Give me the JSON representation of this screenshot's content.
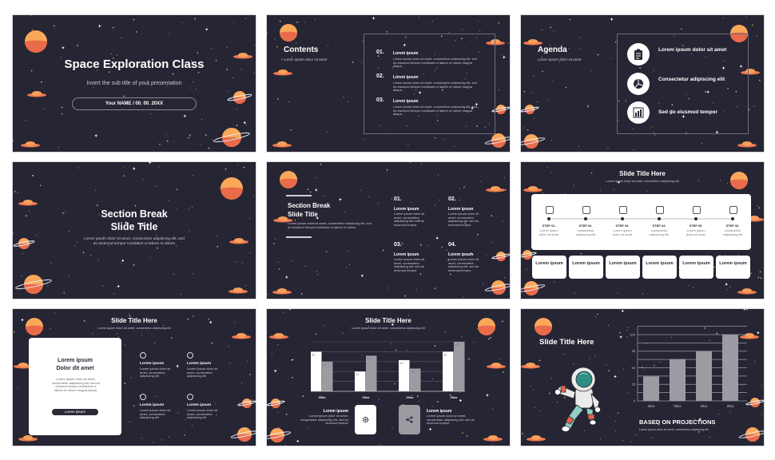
{
  "colors": {
    "background": "#262534",
    "accent_orange": "#f0784f",
    "planet_light": "#f9a85a",
    "bar_gray": "#9b9ba2",
    "white": "#ffffff"
  },
  "slides": [
    {
      "title": "Space Exploration Class",
      "subtitle": "Insert the sub title of your presentation",
      "name_date": "Your NAME  /  00. 00. 20XX"
    },
    {
      "title": "Contents",
      "subtitle": "Lorem ipsum dolor sit amet",
      "items": [
        {
          "num": "01.",
          "title": "Lorem ipsum",
          "desc": "Lorem ipsum dolor sit amet, consectetur adipiscing elit, sed do eiusmod tempor incididunt ut labore et dolore magna aliqua."
        },
        {
          "num": "02.",
          "title": "Lorem ipsum",
          "desc": "Lorem ipsum dolor sit amet, consectetur adipiscing elit, sed do eiusmod tempor incididunt ut labore et dolore magna aliqua."
        },
        {
          "num": "03.",
          "title": "Lorem ipsum",
          "desc": "Lorem ipsum dolor sit amet, consectetur adipiscing elit, sed do eiusmod tempor incididunt ut labore et dolore magna aliqua."
        }
      ]
    },
    {
      "title": "Agenda",
      "subtitle": "Lorem ipsum dolor sit amet",
      "items": [
        {
          "icon": "clipboard-icon",
          "text": "Lorem ipsum dolor sit amet"
        },
        {
          "icon": "pie-chart-icon",
          "text": "Consectetur adipiscing elit"
        },
        {
          "icon": "bar-chart-icon",
          "text": "Sed do eiusmod tempor"
        }
      ]
    },
    {
      "title_line1": "Section Break",
      "title_line2": "Slide Title",
      "desc": "Lorem ipsum dolor sit amet, consectetur adipiscing elit, sed do eiusmod tempor incididunt ut labore et dolore"
    },
    {
      "title_line1": "Section Break",
      "title_line2": "Slide Title",
      "desc": "Lorem ipsum dolor sit amet, consectetur adipiscing elit, sed do eiusmod tempor incididunt ut labore et dolore",
      "items": [
        {
          "num": "01.",
          "title": "Lorem ipsum",
          "desc": "Lorem ipsum dolor sit amet, consectetur adipiscing elit, sed do eiusmod tempor"
        },
        {
          "num": "02.",
          "title": "Lorem ipsum",
          "desc": "Lorem ipsum dolor sit amet, consectetur adipiscing elit, sed do eiusmod tempor"
        },
        {
          "num": "03.",
          "title": "Lorem ipsum",
          "desc": "Lorem ipsum dolor sit amet, consectetur adipiscing elit, sed do eiusmod tempor"
        },
        {
          "num": "04.",
          "title": "Lorem ipsum",
          "desc": "Lorem ipsum dolor sit amet, consectetur adipiscing elit, sed do eiusmod tempor"
        }
      ]
    },
    {
      "title": "Slide Title Here",
      "subtitle": "Lorem ipsum dolor sit amet, consectetur adipiscing elit",
      "steps": [
        {
          "icon": "puzzle-icon",
          "label": "STEP 01.",
          "desc": "Lorem ipsum dolor sit amet"
        },
        {
          "icon": "camera-icon",
          "label": "STEP 02.",
          "desc": "consectetur adipiscing elit"
        },
        {
          "icon": "image-icon",
          "label": "STEP 03.",
          "desc": "Lorem ipsum dolor sit amet"
        },
        {
          "icon": "globe-icon",
          "label": "STEP 04.",
          "desc": "consectetur adipiscing elit"
        },
        {
          "icon": "calendar-icon",
          "label": "STEP 05.",
          "desc": "Lorem ipsum dolor sit amet"
        },
        {
          "icon": "gear-icon",
          "label": "STEP 06.",
          "desc": "consectetur adipiscing elit"
        }
      ],
      "boxes": [
        "Lorem ipsum",
        "Lorem ipsum",
        "Lorem ipsum",
        "Lorem ipsum",
        "Lorem ipsum",
        "Lorem ipsum"
      ]
    },
    {
      "title": "Slide Title Here",
      "subtitle": "Lorem ipsum dolor sit amet, consectetur adipiscing elit",
      "card": {
        "title_line1": "Lorem ipsum",
        "title_line2": "Dolor dit amet",
        "desc": "Lorem ipsum dolor sit amet, consectetur adipiscing elit, sed do eiusmod tempor incididunt ut labore et dolore magna aliqua.",
        "button": "Lorem ipsum"
      },
      "items": [
        {
          "icon": "lightbulb-icon",
          "title": "Lorem ipsum",
          "desc": "Lorem ipsum dolor sit amet, consectetur adipiscing elit"
        },
        {
          "icon": "magnifier-icon",
          "title": "Lorem ipsum",
          "desc": "Lorem ipsum dolor sit amet, consectetur adipiscing elit"
        },
        {
          "icon": "gear-brain-icon",
          "title": "Lorem ipsum",
          "desc": "Lorem ipsum dolor sit amet, consectetur adipiscing elit"
        },
        {
          "icon": "head-icon",
          "title": "Lorem ipsum",
          "desc": "Lorem ipsum dolor sit amet, consectetur adipiscing elit"
        }
      ]
    },
    {
      "title": "Slide Title Here",
      "subtitle": "Lorem ipsum dolor sit amet, consectetur adipiscing elit",
      "chart_data": {
        "type": "bar",
        "categories": [
          "20xx",
          "20xx",
          "20xx",
          "20xx"
        ],
        "series": [
          {
            "values": [
              80,
              40,
              63,
              80
            ],
            "color": "#ffffff"
          },
          {
            "values": [
              60,
              72,
              46,
              100
            ],
            "color": "#9b9ba2"
          }
        ],
        "ylim": [
          0,
          100
        ],
        "grid": true
      },
      "left": {
        "title": "Lorem ipsum",
        "desc": "Lorem ipsum dolor sit amet, consectetur adipiscing elit, sed do eiusmod tempor",
        "icon": "gear-icon"
      },
      "right": {
        "title": "Lorem ipsum",
        "desc": "Lorem ipsum dolor sit amet, consectetur adipiscing elit, sed do eiusmod tempor",
        "icon": "share-icon"
      }
    },
    {
      "title": "Slide Title Here",
      "heading": "BASED ON PROJECTIONS",
      "subtitle": "Lorem ipsum dolor sit amet, consectetur adipiscing elit",
      "chart_data": {
        "type": "bar",
        "categories": [
          "20xx",
          "20xx",
          "20xx",
          "20xx"
        ],
        "values": [
          37,
          63,
          75,
          100
        ],
        "yticks": [
          "0",
          "25",
          "50",
          "75",
          "100"
        ],
        "ylim": [
          0,
          100
        ],
        "grid": true,
        "color": "#9b9ba2"
      }
    }
  ]
}
